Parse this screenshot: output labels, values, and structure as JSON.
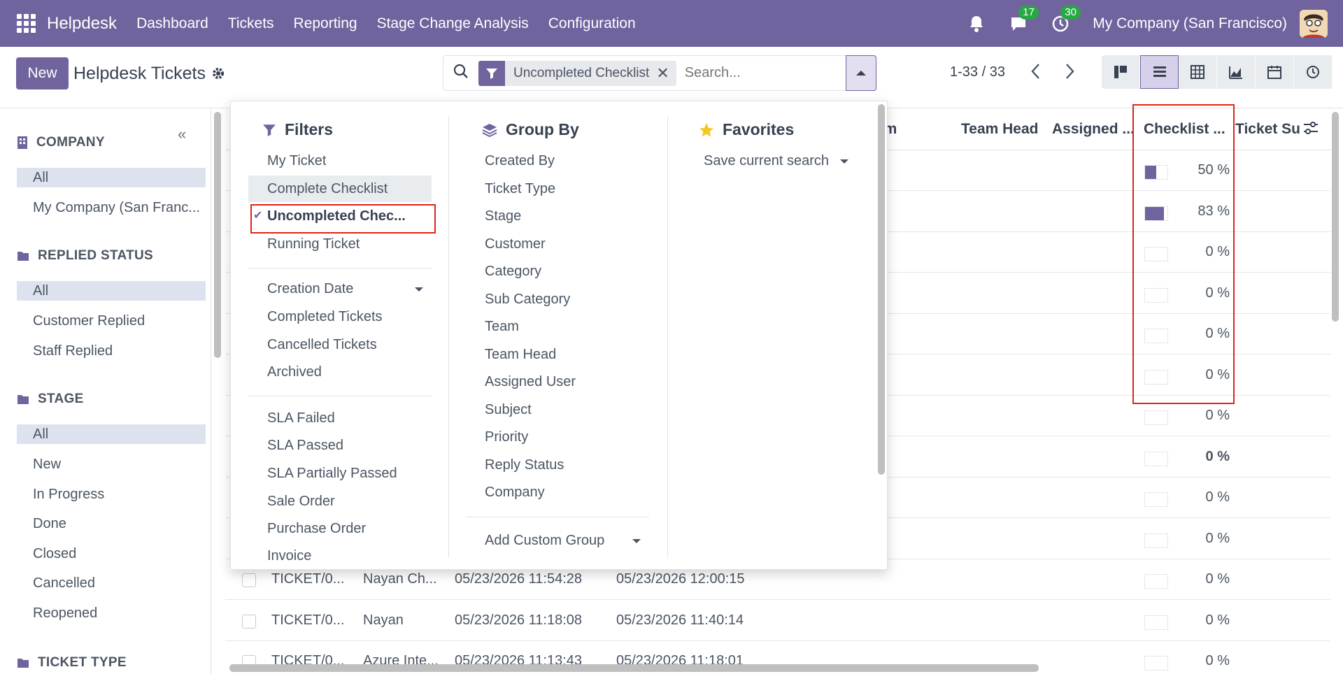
{
  "navbar": {
    "brand": "Helpdesk",
    "menu": [
      "Dashboard",
      "Tickets",
      "Reporting",
      "Stage Change Analysis",
      "Configuration"
    ],
    "messages_count": "17",
    "activities_count": "30",
    "company": "My Company (San Francisco)"
  },
  "control": {
    "new_label": "New",
    "title": "Helpdesk Tickets",
    "facet_label": "Uncompleted Checklist",
    "search_placeholder": "Search...",
    "pager": "1-33 / 33"
  },
  "sidebar": {
    "sections": [
      {
        "title": "COMPANY",
        "items": [
          "All",
          "My Company (San Franc..."
        ]
      },
      {
        "title": "REPLIED STATUS",
        "items": [
          "All",
          "Customer Replied",
          "Staff Replied"
        ]
      },
      {
        "title": "STAGE",
        "items": [
          "All",
          "New",
          "In Progress",
          "Done",
          "Closed",
          "Cancelled",
          "Reopened"
        ]
      },
      {
        "title": "TICKET TYPE",
        "items": []
      }
    ]
  },
  "list": {
    "headers": [
      "am",
      "Team Head",
      "Assigned ...",
      "Checklist ...",
      "Ticket Su"
    ],
    "checklist_values": [
      {
        "pct": "50 %",
        "fill": 0.5
      },
      {
        "pct": "83 %",
        "fill": 0.83
      },
      {
        "pct": "0 %",
        "fill": 0
      },
      {
        "pct": "0 %",
        "fill": 0
      },
      {
        "pct": "0 %",
        "fill": 0
      },
      {
        "pct": "0 %",
        "fill": 0
      },
      {
        "pct": "0 %",
        "fill": 0
      },
      {
        "pct": "0 %",
        "fill": 0,
        "bold": true
      },
      {
        "pct": "0 %",
        "fill": 0
      },
      {
        "pct": "0 %",
        "fill": 0
      },
      {
        "pct": "0 %",
        "fill": 0
      },
      {
        "pct": "0 %",
        "fill": 0
      },
      {
        "pct": "0 %",
        "fill": 0
      }
    ],
    "visible_rows": [
      {
        "ticket": "TICKET/0...",
        "customer": "Nayan Ch...",
        "created": "05/23/2026 11:54:28",
        "updated": "05/23/2026 12:00:15"
      },
      {
        "ticket": "TICKET/0...",
        "customer": "Nayan",
        "created": "05/23/2026 11:18:08",
        "updated": "05/23/2026 11:40:14"
      },
      {
        "ticket": "TICKET/0...",
        "customer": "Azure Inte...",
        "created": "05/23/2026 11:13:43",
        "updated": "05/23/2026 11:18:01"
      }
    ]
  },
  "dropdown": {
    "filters_title": "Filters",
    "filters_group1": [
      "My Ticket",
      "Complete Checklist",
      "Uncompleted Chec...",
      "Running Ticket"
    ],
    "filters_group2": [
      "Creation Date",
      "Completed Tickets",
      "Cancelled Tickets",
      "Archived"
    ],
    "filters_group3": [
      "SLA Failed",
      "SLA Passed",
      "SLA Partially Passed",
      "Sale Order",
      "Purchase Order",
      "Invoice"
    ],
    "groupby_title": "Group By",
    "groupby_items": [
      "Created By",
      "Ticket Type",
      "Stage",
      "Customer",
      "Category",
      "Sub Category",
      "Team",
      "Team Head",
      "Assigned User",
      "Subject",
      "Priority",
      "Reply Status",
      "Company"
    ],
    "add_custom_group": "Add Custom Group",
    "favorites_title": "Favorites",
    "save_current_search": "Save current search"
  },
  "colors": {
    "brand": "#71639e",
    "highlight": "#e0231b",
    "badge": "#28a745"
  }
}
